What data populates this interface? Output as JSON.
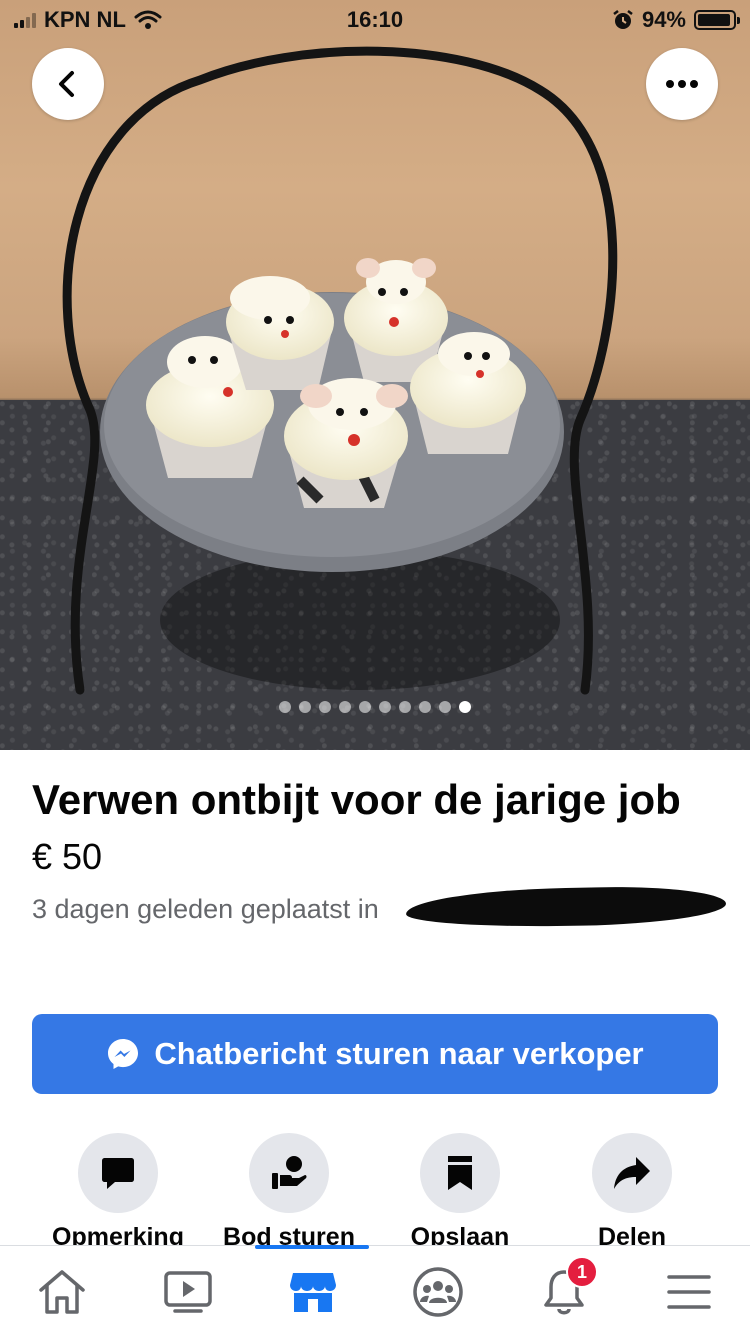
{
  "status_bar": {
    "carrier": "KPN NL",
    "time": "16:10",
    "battery": "94%",
    "battery_level": 0.94
  },
  "photo": {
    "description_icon": "cupcakes-photo",
    "slide_count": 10,
    "active_slide": 10
  },
  "listing": {
    "title": "Verwen ontbijt voor de jarige job",
    "price": "€ 50",
    "posted": "3 dagen geleden geplaatst in"
  },
  "cta": {
    "label": "Chatbericht sturen naar verkoper",
    "color": "#3578e5"
  },
  "actions": [
    {
      "label": "Opmerking",
      "icon": "comment-icon"
    },
    {
      "label": "Bod sturen",
      "icon": "offer-icon"
    },
    {
      "label": "Opslaan",
      "icon": "bookmark-icon"
    },
    {
      "label": "Delen",
      "icon": "share-icon"
    }
  ],
  "tabbar": {
    "active": "marketplace",
    "accent": "#1877f2",
    "notifications_badge": "1",
    "tabs": [
      "home",
      "watch",
      "marketplace",
      "groups",
      "notifications",
      "menu"
    ]
  }
}
